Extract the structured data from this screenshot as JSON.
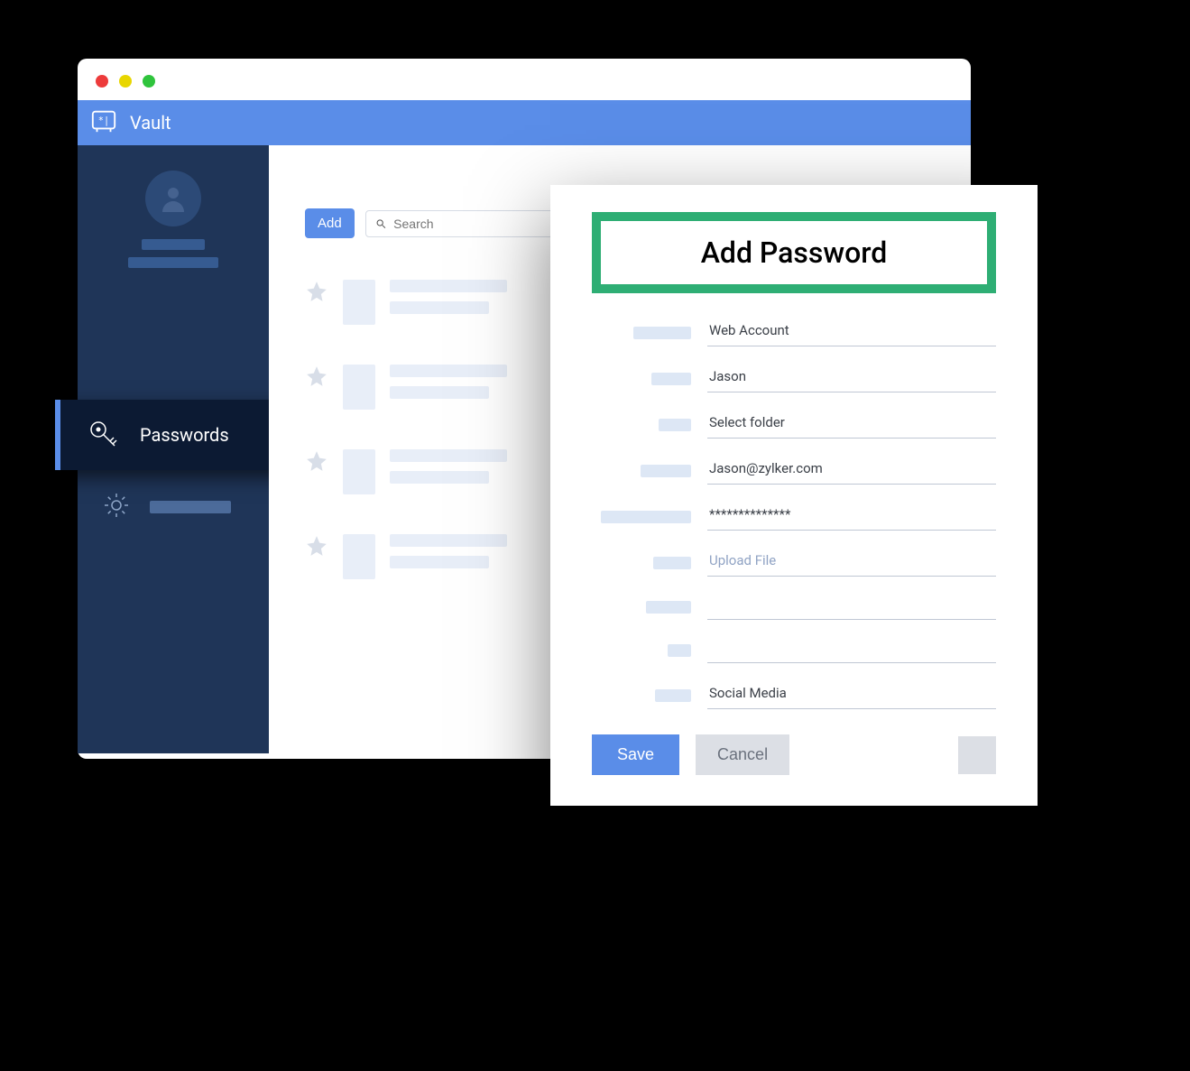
{
  "header": {
    "title": "Vault"
  },
  "sidebar": {
    "active_label": "Passwords"
  },
  "toolbar": {
    "add_label": "Add",
    "search_placeholder": "Search"
  },
  "panel": {
    "title": "Add Password",
    "fields": {
      "account_type": "Web Account",
      "name": "Jason",
      "folder": "Select folder",
      "email": "Jason@zylker.com",
      "password": "**************",
      "upload": "Upload File",
      "tag": "Social Media"
    },
    "save_label": "Save",
    "cancel_label": "Cancel"
  }
}
